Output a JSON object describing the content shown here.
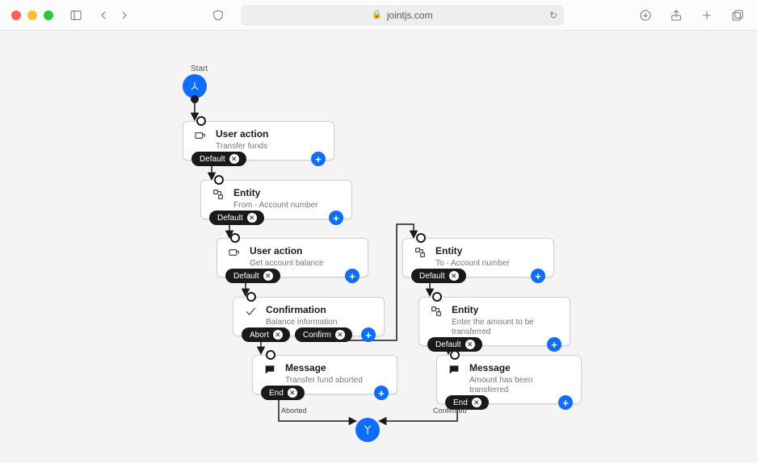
{
  "browser": {
    "url_host": "jointjs.com"
  },
  "start_label": "Start",
  "nodes": {
    "a": {
      "title": "User action",
      "sub": "Transfer funds",
      "outs": [
        "Default"
      ]
    },
    "b": {
      "title": "Entity",
      "sub": "From - Account number",
      "outs": [
        "Default"
      ]
    },
    "c": {
      "title": "User action",
      "sub": "Get account balance",
      "outs": [
        "Default"
      ]
    },
    "d": {
      "title": "Confirmation",
      "sub": "Balance information",
      "outs": [
        "Abort",
        "Confirm"
      ]
    },
    "e": {
      "title": "Message",
      "sub": "Transfer fund aborted",
      "outs": [
        "End"
      ]
    },
    "f": {
      "title": "Entity",
      "sub": "To - Account number",
      "outs": [
        "Default"
      ]
    },
    "g": {
      "title": "Entity",
      "sub": "Enter the amount to be transferred",
      "outs": [
        "Default"
      ]
    },
    "h": {
      "title": "Message",
      "sub": "Amount has been transferred",
      "outs": [
        "End"
      ]
    }
  },
  "edge_labels": {
    "aborted": "Aborted",
    "confirmed": "Confirmed"
  }
}
